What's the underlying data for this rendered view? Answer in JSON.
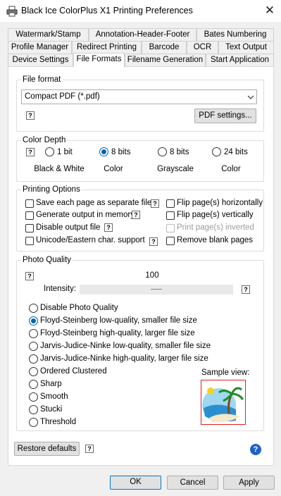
{
  "window": {
    "title": "Black Ice ColorPlus X1 Printing Preferences",
    "close_glyph": "✕"
  },
  "tabs": {
    "row1": [
      "Watermark/Stamp",
      "Annotation-Header-Footer",
      "Bates Numbering"
    ],
    "row2": [
      "Profile Manager",
      "Redirect Printing",
      "Barcode",
      "OCR",
      "Text Output"
    ],
    "row3": [
      "Device Settings",
      "File Formats",
      "Filename Generation",
      "Start Application"
    ],
    "active": "File Formats"
  },
  "file_format": {
    "legend": "File format",
    "selected": "Compact PDF (*.pdf)",
    "pdf_settings": "PDF settings...",
    "help": "?"
  },
  "color_depth": {
    "legend": "Color Depth",
    "help": "?",
    "options": [
      {
        "bits": "1 bit",
        "desc": "Black & White",
        "selected": false
      },
      {
        "bits": "8 bits",
        "desc": "Color",
        "selected": true
      },
      {
        "bits": "8 bits",
        "desc": "Grayscale",
        "selected": false
      },
      {
        "bits": "24 bits",
        "desc": "Color",
        "selected": false
      }
    ]
  },
  "printing_options": {
    "legend": "Printing Options",
    "help": "?",
    "left": [
      {
        "label": "Save each page as separate file",
        "checked": false,
        "help": true
      },
      {
        "label": "Generate output in memory",
        "checked": false,
        "help": true
      },
      {
        "label": "Disable output file",
        "checked": false,
        "help": true
      },
      {
        "label": "Unicode/Eastern char. support",
        "checked": false,
        "help": true
      }
    ],
    "right": [
      {
        "label": "Flip page(s) horizontally",
        "checked": false,
        "disabled": false
      },
      {
        "label": "Flip page(s) vertically",
        "checked": false,
        "disabled": false
      },
      {
        "label": "Print page(s) inverted",
        "checked": false,
        "disabled": true
      },
      {
        "label": "Remove blank pages",
        "checked": false,
        "disabled": false
      }
    ]
  },
  "photo_quality": {
    "legend": "Photo Quality",
    "help": "?",
    "intensity_label": "Intensity:",
    "intensity_value": "100",
    "options": [
      {
        "label": "Disable Photo Quality",
        "selected": false
      },
      {
        "label": "Floyd-Steinberg low-quality, smaller file size",
        "selected": true
      },
      {
        "label": "Floyd-Steinberg high-quality, larger file size",
        "selected": false
      },
      {
        "label": "Jarvis-Judice-Ninke low-quality, smaller file size",
        "selected": false
      },
      {
        "label": "Jarvis-Judice-Ninke high-quality, larger file size",
        "selected": false
      },
      {
        "label": "Ordered Clustered",
        "selected": false
      },
      {
        "label": "Sharp",
        "selected": false
      },
      {
        "label": "Smooth",
        "selected": false
      },
      {
        "label": "Stucki",
        "selected": false
      },
      {
        "label": "Threshold",
        "selected": false
      }
    ],
    "sample_view_label": "Sample view:"
  },
  "footer": {
    "restore_defaults": "Restore defaults",
    "help": "?",
    "ok": "OK",
    "cancel": "Cancel",
    "apply": "Apply",
    "info_glyph": "?"
  },
  "colors": {
    "accent": "#0063b1",
    "focus": "#0078d7"
  }
}
